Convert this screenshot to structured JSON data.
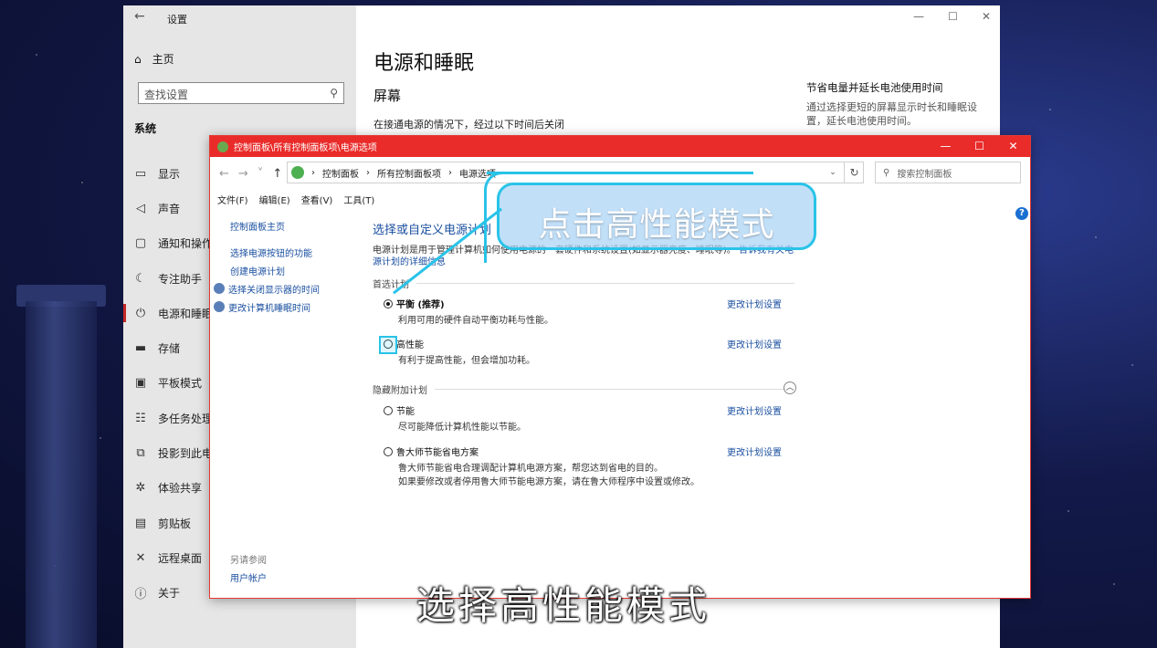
{
  "settings": {
    "title": "设置",
    "home": "主页",
    "search_placeholder": "查找设置",
    "section": "系统",
    "nav": [
      "显示",
      "声音",
      "通知和操作",
      "专注助手",
      "电源和睡眠",
      "存储",
      "平板模式",
      "多任务处理",
      "投影到此电",
      "体验共享",
      "剪贴板",
      "远程桌面",
      "关于"
    ],
    "page_title": "电源和睡眠",
    "screen_heading": "屏幕",
    "screen_text": "在接通电源的情况下，经过以下时间后关闭",
    "tip_title": "节省电量并延长电池使用时间",
    "tip_text": "通过选择更短的屏幕显示时长和睡眠设置，延长电池使用时间。"
  },
  "control_panel": {
    "title": "控制面板\\所有控制面板项\\电源选项",
    "breadcrumb": [
      "控制面板",
      "所有控制面板项",
      "电源选项"
    ],
    "search_placeholder": "搜索控制面板",
    "menu": [
      "文件(F)",
      "编辑(E)",
      "查看(V)",
      "工具(T)"
    ],
    "left_home": "控制面板主页",
    "left_links": [
      "选择电源按钮的功能",
      "创建电源计划",
      "选择关闭显示器的时间",
      "更改计算机睡眠时间"
    ],
    "see_also": "另请参阅",
    "user_accounts": "用户帐户",
    "heading": "选择或自定义电源计划",
    "desc_text": "电源计划是用于管理计算机如何使用电源的一套硬件和系统设置(如显示器亮度、睡眠等)。",
    "desc_link": "告诉我有关电源计划的详细信息",
    "preferred_label": "首选计划",
    "hidden_label": "隐藏附加计划",
    "change_link": "更改计划设置",
    "plans": [
      {
        "name": "平衡 (推荐)",
        "desc": "利用可用的硬件自动平衡功耗与性能。",
        "selected": true
      },
      {
        "name": "高性能",
        "desc": "有利于提高性能，但会增加功耗。",
        "selected": false
      },
      {
        "name": "节能",
        "desc": "尽可能降低计算机性能以节能。",
        "selected": false
      },
      {
        "name": "鲁大师节能省电方案",
        "desc": "鲁大师节能省电合理调配计算机电源方案，帮您达到省电的目的。",
        "desc2": "如果要修改或者停用鲁大师节能电源方案，请在鲁大师程序中设置或修改。",
        "selected": false
      }
    ]
  },
  "annotation": {
    "callout": "点击高性能模式",
    "subtitle": "选择高性能模式",
    "accent": "#29c3e8"
  }
}
